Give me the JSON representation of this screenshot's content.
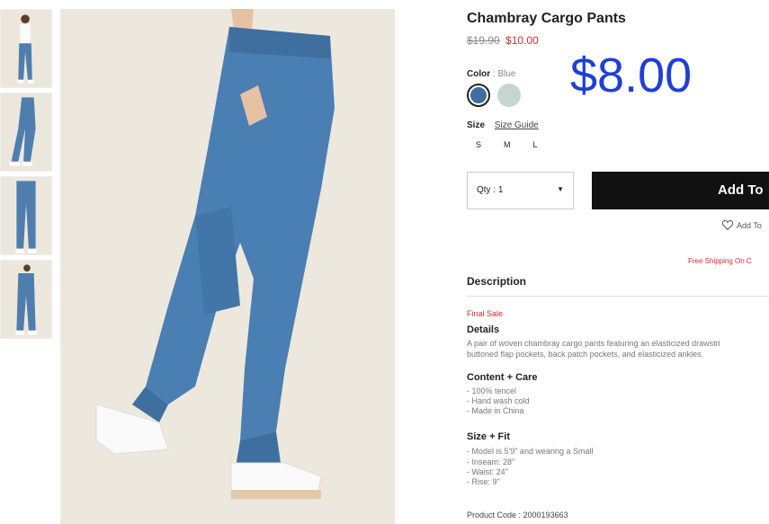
{
  "product": {
    "title": "Chambray Cargo Pants",
    "old_price": "$19.90",
    "sale_price": "$10.00",
    "overlay_price": "$8.00"
  },
  "color": {
    "label": "Color",
    "separator": ":",
    "value": "Blue",
    "swatch_colors": [
      "#3d6e9e",
      "#c5d6cf"
    ]
  },
  "size": {
    "label": "Size",
    "guide_label": "Size Guide",
    "options": [
      "S",
      "M",
      "L"
    ]
  },
  "quantity": {
    "label": "Qty : 1"
  },
  "actions": {
    "add_label": "Add To",
    "wishlist_label": "Add To",
    "shipping_text": "Free Shipping On C"
  },
  "description": {
    "title": "Description",
    "final_sale": "Final Sale",
    "details_heading": "Details",
    "details_line1": "A pair of woven chambray cargo pants featuring an elasticized drawstri",
    "details_line2": "buttoned flap pockets, back patch pockets, and elasticized ankles.",
    "content_heading": "Content + Care",
    "content_items": [
      "- 100% tencel",
      "- Hand wash cold",
      "- Made in China"
    ],
    "fit_heading": "Size + Fit",
    "fit_items": [
      "- Model is 5'9\" and wearing a Small",
      "- Inseam: 28\"",
      "- Waist: 24\"",
      "- Rise: 9\""
    ],
    "product_code": "Product Code : 2000193663"
  }
}
